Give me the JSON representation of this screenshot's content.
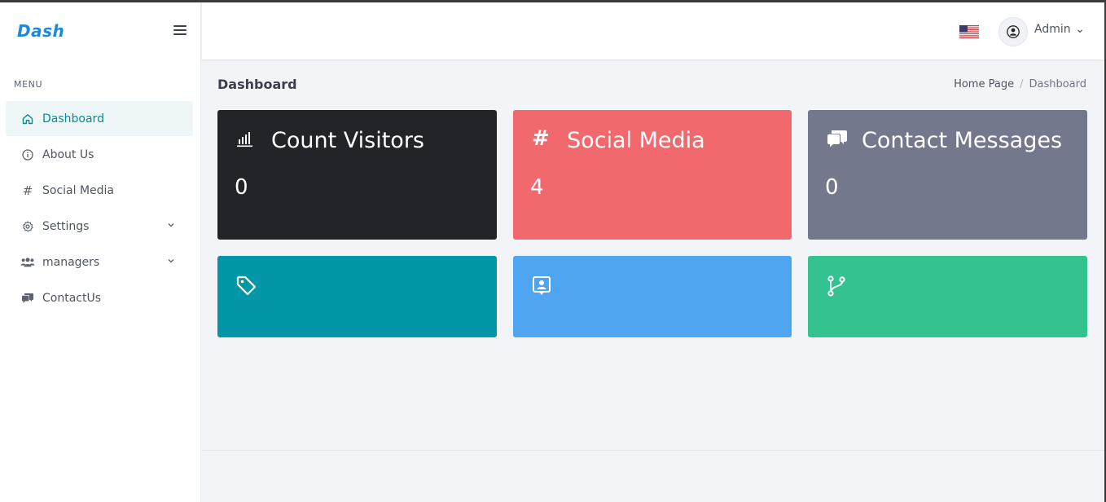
{
  "brand": {
    "logo_text": "Dash",
    "logo_color": "#1e88d9"
  },
  "sidebar": {
    "menu_title": "MENU",
    "items": [
      {
        "label": "Dashboard",
        "icon": "home-icon",
        "active": true
      },
      {
        "label": "About Us",
        "icon": "info-icon"
      },
      {
        "label": "Social Media",
        "icon": "hash-icon"
      },
      {
        "label": "Settings",
        "icon": "gear-icon",
        "has_submenu": true
      },
      {
        "label": "managers",
        "icon": "users-icon",
        "has_submenu": true
      },
      {
        "label": "ContactUs",
        "icon": "chat-icon"
      }
    ]
  },
  "header": {
    "language": "en-US flag",
    "user_name": "Admin"
  },
  "page": {
    "title": "Dashboard",
    "breadcrumb": {
      "home": "Home Page",
      "separator": "/",
      "current": "Dashboard"
    }
  },
  "cards": [
    {
      "title": "Count Visitors",
      "value": "0",
      "icon": "bar-chart-icon",
      "color": "#212429"
    },
    {
      "title": "Social Media",
      "value": "4",
      "icon": "hash-icon",
      "color": "#f2696d"
    },
    {
      "title": "Contact Messages",
      "value": "0",
      "icon": "chat-icon",
      "color": "#73788d"
    },
    {
      "title": "",
      "value": "",
      "icon": "tag-icon",
      "color": "#0396a6"
    },
    {
      "title": "",
      "value": "",
      "icon": "contact-card-icon",
      "color": "#50a5f1"
    },
    {
      "title": "",
      "value": "",
      "icon": "git-branch-icon",
      "color": "#34c38f"
    }
  ],
  "colors": {
    "accent": "#058b94",
    "background": "#f3f4f7"
  }
}
